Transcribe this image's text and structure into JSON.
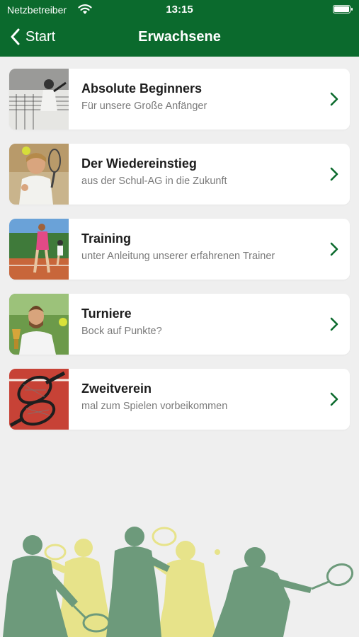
{
  "status_bar": {
    "carrier": "Netzbetreiber",
    "time": "13:15"
  },
  "nav": {
    "back_label": "Start",
    "title": "Erwachsene"
  },
  "colors": {
    "header": "#0b6a2d",
    "chevron": "#0b6a2d",
    "background": "#efefef"
  },
  "items": [
    {
      "title": "Absolute Beginners",
      "subtitle": "Für unsere Große Anfänger",
      "icon": "chevron-right-icon"
    },
    {
      "title": "Der Wiedereinstieg",
      "subtitle": "aus der Schul-AG in die Zukunft",
      "icon": "chevron-right-icon"
    },
    {
      "title": "Training",
      "subtitle": "unter Anleitung unserer erfahrenen Trainer",
      "icon": "chevron-right-icon"
    },
    {
      "title": "Turniere",
      "subtitle": "Bock auf Punkte?",
      "icon": "chevron-right-icon"
    },
    {
      "title": "Zweitverein",
      "subtitle": "mal zum Spielen vorbeikommen",
      "icon": "chevron-right-icon"
    }
  ]
}
